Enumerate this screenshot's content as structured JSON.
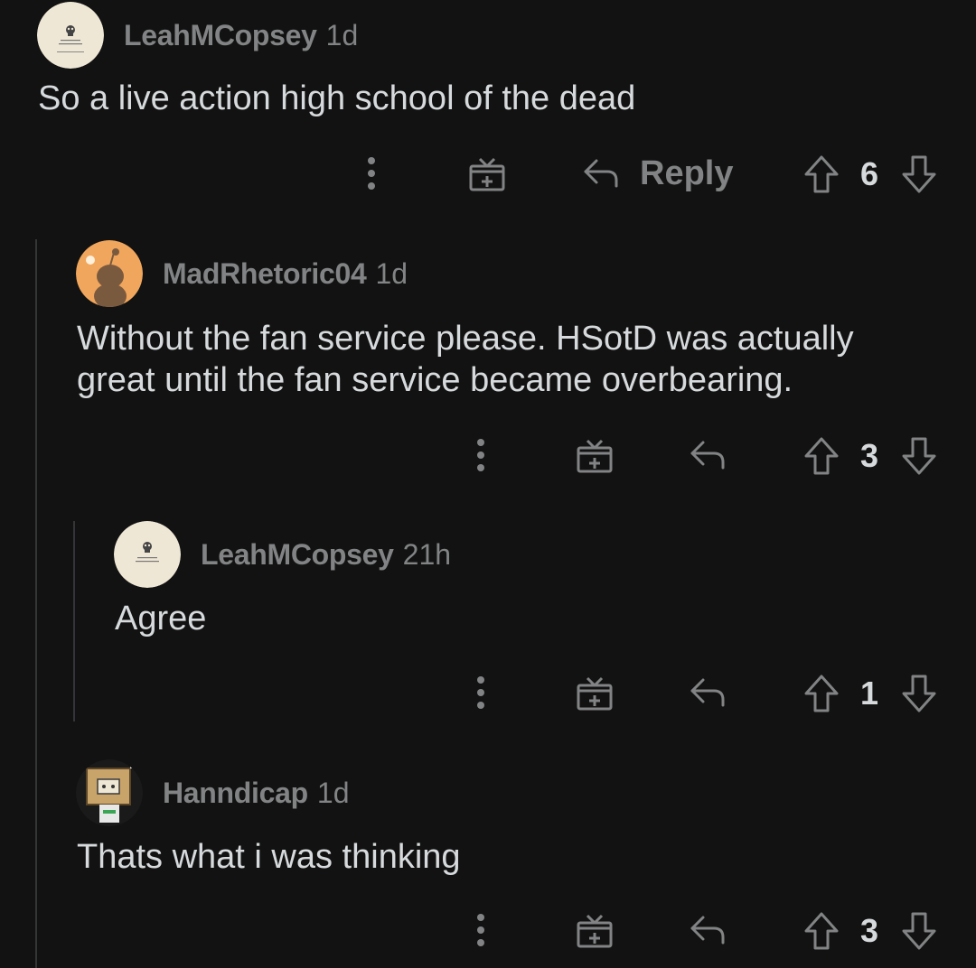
{
  "comments": [
    {
      "username": "LeahMCopsey",
      "time": "1d",
      "body": "So a live action high school of the dead",
      "reply_label": "Reply",
      "votes": "6",
      "avatar": "skull-avatar"
    },
    {
      "username": "MadRhetoric04",
      "time": "1d",
      "body": "Without the fan service please. HSotD was actually\ngreat until the fan service became overbearing.",
      "votes": "3",
      "avatar": "snoo-avatar"
    },
    {
      "username": "LeahMCopsey",
      "time": "21h",
      "body": "Agree",
      "votes": "1",
      "avatar": "skull-avatar"
    },
    {
      "username": "Hanndicap",
      "time": "1d",
      "body": "Thats what i was thinking",
      "votes": "3",
      "avatar": "boxhead-avatar"
    }
  ],
  "colors": {
    "background": "#121212",
    "text": "#d7dadc",
    "muted": "#818384",
    "thread_line": "#343536"
  }
}
